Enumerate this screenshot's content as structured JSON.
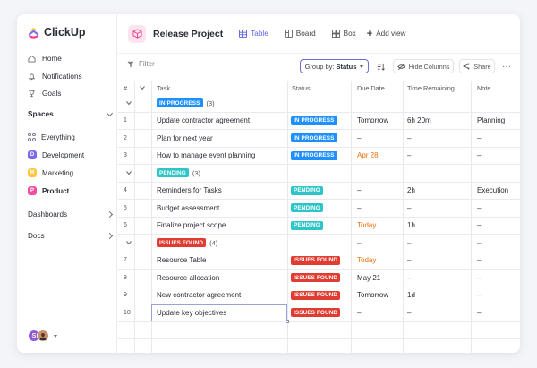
{
  "app": {
    "logo_text": "ClickUp"
  },
  "sidebar": {
    "nav": [
      {
        "label": "Home",
        "icon": "home-icon"
      },
      {
        "label": "Notifications",
        "icon": "bell-icon"
      },
      {
        "label": "Goals",
        "icon": "trophy-icon"
      }
    ],
    "spaces_label": "Spaces",
    "spaces": [
      {
        "label": "Everything",
        "badge": "",
        "color": ""
      },
      {
        "label": "Development",
        "badge": "D",
        "color": "#7b68ee"
      },
      {
        "label": "Marketing",
        "badge": "M",
        "color": "#ffc53d"
      },
      {
        "label": "Product",
        "badge": "P",
        "color": "#f04fa0"
      }
    ],
    "dashboards_label": "Dashboards",
    "docs_label": "Docs",
    "user_initial": "S"
  },
  "header": {
    "project_title": "Release Project",
    "views": [
      {
        "label": "Table",
        "icon": "table-icon",
        "active": true
      },
      {
        "label": "Board",
        "icon": "board-icon",
        "active": false
      },
      {
        "label": "Box",
        "icon": "box-icon",
        "active": false
      }
    ],
    "add_view_label": "Add view"
  },
  "toolbar": {
    "filter_label": "Filter",
    "group_by_label": "Group by:",
    "group_by_value": "Status",
    "hide_columns_label": "Hide Columns",
    "share_label": "Share"
  },
  "table": {
    "columns": {
      "num": "#",
      "task": "Task",
      "status": "Status",
      "due": "Due Date",
      "remaining": "Time Remaining",
      "note": "Note"
    },
    "groups": [
      {
        "status": "IN PROGRESS",
        "count": "(3)",
        "color": "#1e90ff",
        "rows": [
          {
            "n": "1",
            "task": "Update contractor agreement",
            "due": "Tomorrow",
            "remaining": "6h 20m",
            "note": "Planning"
          },
          {
            "n": "2",
            "task": "Plan for next year",
            "due": "–",
            "remaining": "–",
            "note": "–"
          },
          {
            "n": "3",
            "task": "How to manage event planning",
            "due": "Apr 28",
            "due_color": "#e8700a",
            "remaining": "–",
            "note": "–"
          }
        ]
      },
      {
        "status": "PENDING",
        "count": "(3)",
        "color": "#2ec5c9",
        "rows": [
          {
            "n": "4",
            "task": "Reminders for Tasks",
            "due": "–",
            "remaining": "2h",
            "note": "Execution"
          },
          {
            "n": "5",
            "task": "Budget assessment",
            "due": "–",
            "remaining": "–",
            "note": "–"
          },
          {
            "n": "6",
            "task": "Finalize project scope",
            "due": "Today",
            "due_color": "#e8700a",
            "remaining": "1h",
            "note": "–"
          }
        ]
      },
      {
        "status": "ISSUES FOUND",
        "count": "(4)",
        "color": "#e03c31",
        "header_due": "–",
        "header_remaining": "–",
        "header_note": "–",
        "rows": [
          {
            "n": "7",
            "task": "Resource Table",
            "due": "Today",
            "due_color": "#e8700a",
            "remaining": "–",
            "note": "–"
          },
          {
            "n": "8",
            "task": "Resource allocation",
            "due": "May 21",
            "remaining": "–",
            "note": "–"
          },
          {
            "n": "9",
            "task": "New contractor agreement",
            "due": "Tomorrow",
            "remaining": "1d",
            "note": "–"
          },
          {
            "n": "10",
            "task": "Update key objectives",
            "due": "–",
            "remaining": "–",
            "note": "–"
          }
        ]
      }
    ]
  }
}
